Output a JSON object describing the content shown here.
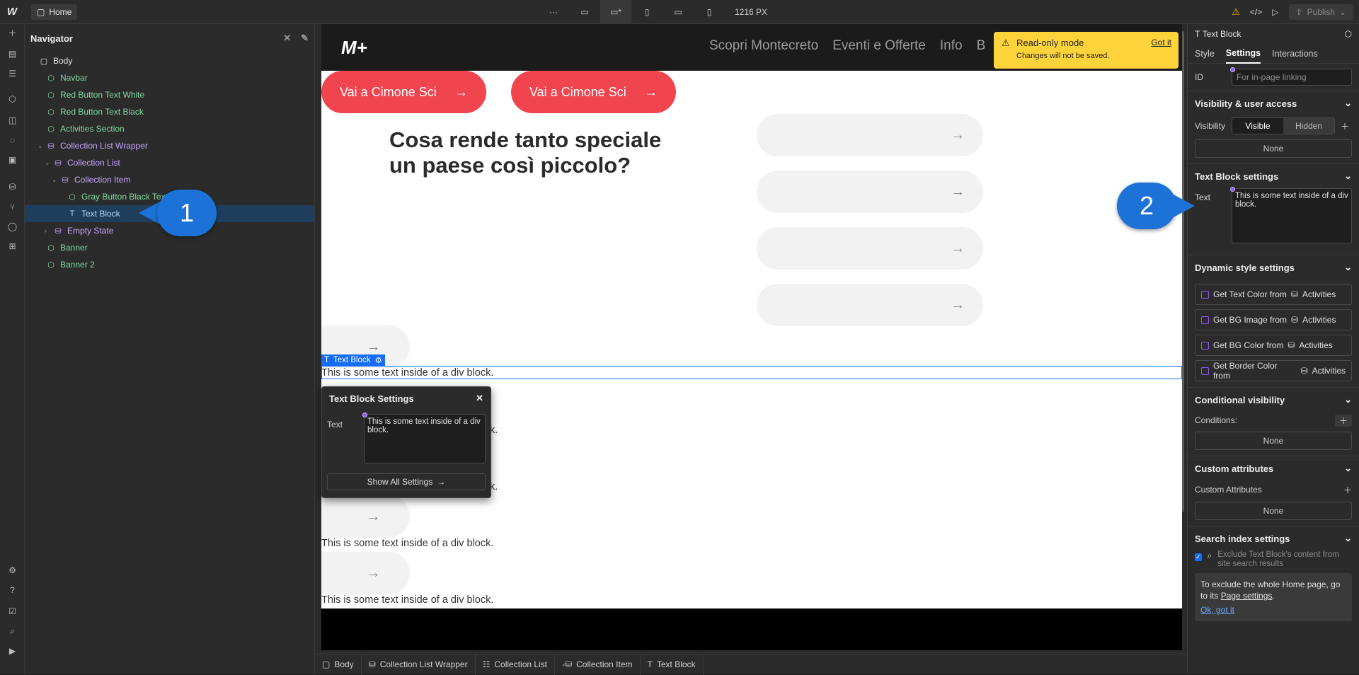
{
  "topbar": {
    "page_name": "Home",
    "width_label": "1216 PX",
    "publish_label": "Publish"
  },
  "navigator": {
    "title": "Navigator",
    "items": [
      {
        "label": "Body",
        "depth": 0,
        "kind": "body"
      },
      {
        "label": "Navbar",
        "depth": 1,
        "kind": "component"
      },
      {
        "label": "Red Button Text White",
        "depth": 1,
        "kind": "component"
      },
      {
        "label": "Red Button Text Black",
        "depth": 1,
        "kind": "component"
      },
      {
        "label": "Activities Section",
        "depth": 1,
        "kind": "component"
      },
      {
        "label": "Collection List Wrapper",
        "depth": 1,
        "kind": "collection"
      },
      {
        "label": "Collection List",
        "depth": 2,
        "kind": "collection"
      },
      {
        "label": "Collection Item",
        "depth": 3,
        "kind": "collection"
      },
      {
        "label": "Gray Button Black Text",
        "depth": 4,
        "kind": "component"
      },
      {
        "label": "Text Block",
        "depth": 4,
        "kind": "text"
      },
      {
        "label": "Empty State",
        "depth": 2,
        "kind": "collection"
      },
      {
        "label": "Banner",
        "depth": 1,
        "kind": "component"
      },
      {
        "label": "Banner 2",
        "depth": 1,
        "kind": "component"
      }
    ]
  },
  "callouts": {
    "one": "1",
    "two": "2"
  },
  "site": {
    "logo": "M+",
    "menu": [
      "Scopri Montecreto",
      "Eventi e Offerte",
      "Info",
      "B"
    ],
    "red_button_label": "Vai a Cimone Sci",
    "hero_title": "Cosa rende tanto speciale un paese così piccolo?",
    "item_text": "This is some text inside of a div block.",
    "item_text_short": "k.",
    "arrow": "→",
    "selected_label": "Text Block"
  },
  "readonly": {
    "title": "Read-only mode",
    "subtitle": "Changes will not be saved.",
    "action": "Got it"
  },
  "popup": {
    "title": "Text Block Settings",
    "text_label": "Text",
    "text_value": "This is some text inside of a div block.",
    "button": "Show All Settings"
  },
  "breadcrumb": [
    "Body",
    "Collection List Wrapper",
    "Collection List",
    "Collection Item",
    "Text Block"
  ],
  "right_panel": {
    "element": "Text Block",
    "tabs": [
      "Style",
      "Settings",
      "Interactions"
    ],
    "id_label": "ID",
    "id_placeholder": "For in-page linking",
    "visibility_section": "Visibility & user access",
    "visibility_label": "Visibility",
    "visible": "Visible",
    "hidden": "Hidden",
    "none": "None",
    "text_block_section": "Text Block settings",
    "text_label": "Text",
    "text_value": "This is some text inside of a div block.",
    "dynamic_section": "Dynamic style settings",
    "dynamic_items": [
      {
        "label": "Get Text Color from",
        "source": "Activities"
      },
      {
        "label": "Get BG Image from",
        "source": "Activities"
      },
      {
        "label": "Get BG Color from",
        "source": "Activities"
      },
      {
        "label": "Get Border Color from",
        "source": "Activities"
      }
    ],
    "conditional_section": "Conditional visibility",
    "conditions_label": "Conditions:",
    "custom_attr_section": "Custom attributes",
    "custom_attr_label": "Custom Attributes",
    "search_section": "Search index settings",
    "exclude_text": "Exclude Text Block's content from site search results",
    "note_text_1": "To exclude the whole Home page, go to its",
    "note_link": "Page settings",
    "note_ok": "Ok, got it"
  },
  "colors": {
    "accent": "#146ef5",
    "red": "#f0444e",
    "callout": "#1d72d8",
    "warning": "#ffd43b"
  }
}
